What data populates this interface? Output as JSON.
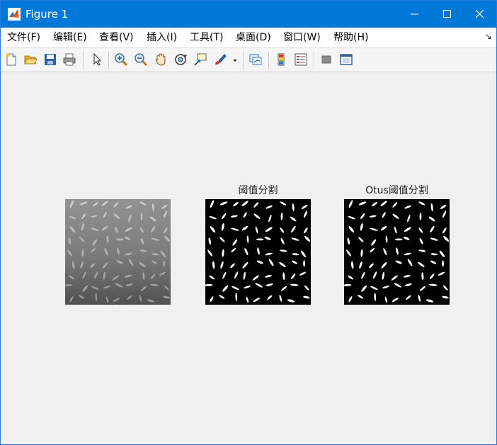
{
  "window": {
    "title": "Figure 1",
    "app_icon": "matlab-icon",
    "controls": [
      "minimize-icon",
      "maximize-icon",
      "close-icon"
    ]
  },
  "menu": {
    "items": [
      {
        "label": "文件(F)"
      },
      {
        "label": "编辑(E)"
      },
      {
        "label": "查看(V)"
      },
      {
        "label": "插入(I)"
      },
      {
        "label": "工具(T)"
      },
      {
        "label": "桌面(D)"
      },
      {
        "label": "窗口(W)"
      },
      {
        "label": "帮助(H)"
      }
    ],
    "overflow_icon": "menu-overflow-icon"
  },
  "toolbar": {
    "icons": [
      "new-figure-icon",
      "open-file-icon",
      "save-icon",
      "print-icon",
      "edit-plot-arrow-icon",
      "zoom-in-icon",
      "zoom-out-icon",
      "pan-hand-icon",
      "rotate-3d-icon",
      "data-cursor-icon",
      "brush-icon",
      "brush-dropdown-icon",
      "link-plot-icon",
      "colorbar-icon",
      "legend-icon",
      "hide-plot-tools-icon",
      "show-plot-tools-icon"
    ]
  },
  "figure": {
    "subplots": [
      {
        "title": "",
        "image": "grayscale rice grains"
      },
      {
        "title": "阈值分割",
        "image": "binary thresholded rice grains"
      },
      {
        "title": "Otus阈值分割",
        "image": "binary Otsu thresholded rice grains"
      }
    ],
    "background_color": "#f0f0f0"
  },
  "colors": {
    "titlebar": "#0078d7",
    "titlebar_text": "#ffffff",
    "menubar": "#ffffff"
  }
}
